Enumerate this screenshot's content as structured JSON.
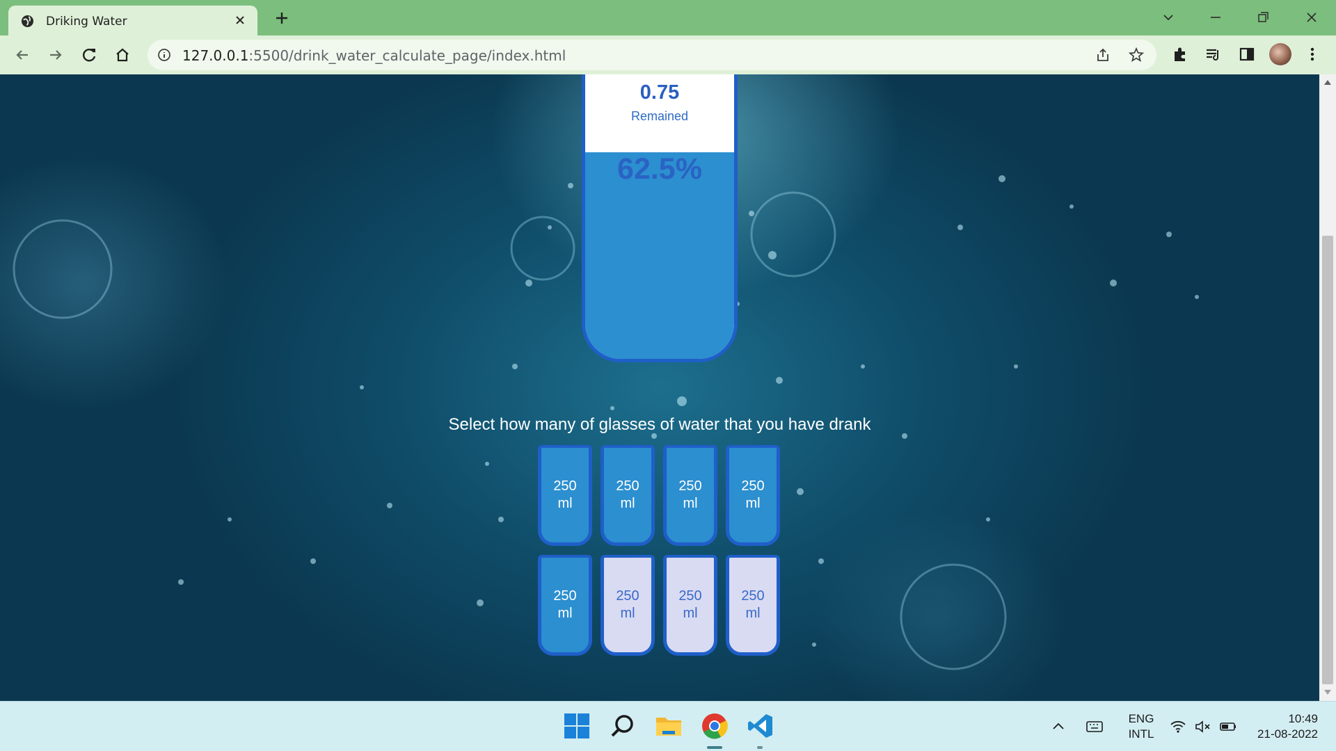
{
  "browser": {
    "tab_title": "Driking Water",
    "url_host": "127.0.0.1",
    "url_rest": ":5500/drink_water_calculate_page/index.html"
  },
  "page": {
    "remained_value": "0.75",
    "remained_label": "Remained",
    "percentage": "62.5%",
    "instruction": "Select how many of glasses of water that you have drank",
    "cups": [
      {
        "label_line1": "250",
        "label_line2": "ml",
        "filled": true
      },
      {
        "label_line1": "250",
        "label_line2": "ml",
        "filled": true
      },
      {
        "label_line1": "250",
        "label_line2": "ml",
        "filled": true
      },
      {
        "label_line1": "250",
        "label_line2": "ml",
        "filled": true
      },
      {
        "label_line1": "250",
        "label_line2": "ml",
        "filled": true
      },
      {
        "label_line1": "250",
        "label_line2": "ml",
        "filled": false
      },
      {
        "label_line1": "250",
        "label_line2": "ml",
        "filled": false
      },
      {
        "label_line1": "250",
        "label_line2": "ml",
        "filled": false
      }
    ],
    "colors": {
      "water": "#2c8fd0",
      "border": "#1f5fc9",
      "empty": "#d9dbf3"
    }
  },
  "taskbar": {
    "apps": [
      "windows-start-icon",
      "search-icon",
      "file-explorer-icon",
      "chrome-icon",
      "vscode-icon"
    ],
    "lang_line1": "ENG",
    "lang_line2": "INTL",
    "time": "10:49",
    "date": "21-08-2022"
  }
}
